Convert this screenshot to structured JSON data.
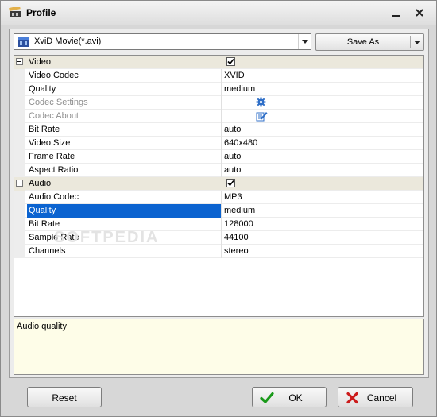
{
  "window": {
    "title": "Profile",
    "controls": {
      "minimize": "_",
      "close": "×"
    }
  },
  "profile_select": {
    "value": "XviD Movie(*.avi)"
  },
  "save_as_button": {
    "label": "Save As"
  },
  "property_grid": {
    "video_category": {
      "label": "Video",
      "checked": true
    },
    "video_rows": [
      {
        "name": "Video Codec",
        "value": "XVID"
      },
      {
        "name": "Quality",
        "value": "medium"
      },
      {
        "name": "Codec Settings",
        "value": ""
      },
      {
        "name": "Codec About",
        "value": ""
      },
      {
        "name": "Bit Rate",
        "value": "auto"
      },
      {
        "name": "Video Size",
        "value": "640x480"
      },
      {
        "name": "Frame Rate",
        "value": "auto"
      },
      {
        "name": "Aspect Ratio",
        "value": "auto"
      }
    ],
    "audio_category": {
      "label": "Audio",
      "checked": true
    },
    "audio_rows": [
      {
        "name": "Audio Codec",
        "value": "MP3"
      },
      {
        "name": "Quality",
        "value": "medium"
      },
      {
        "name": "Bit Rate",
        "value": "128000"
      },
      {
        "name": "Sample Rate",
        "value": "44100"
      },
      {
        "name": "Channels",
        "value": "stereo"
      }
    ]
  },
  "watermark": "SOFTPEDIA",
  "description": {
    "text": "Audio quality"
  },
  "buttons": {
    "reset": "Reset",
    "ok": "OK",
    "cancel": "Cancel"
  },
  "colors": {
    "selection": "#0b63d0",
    "category_band": "#ebe8dc",
    "description_bg": "#fefde8",
    "ok_icon": "#1a9a1a",
    "cancel_icon": "#cc1c1c",
    "codec_icon": "#2f6fc8"
  },
  "icons": [
    "film-icon",
    "gear-icon",
    "edit-icon",
    "checkmark-icon",
    "cross-icon"
  ]
}
